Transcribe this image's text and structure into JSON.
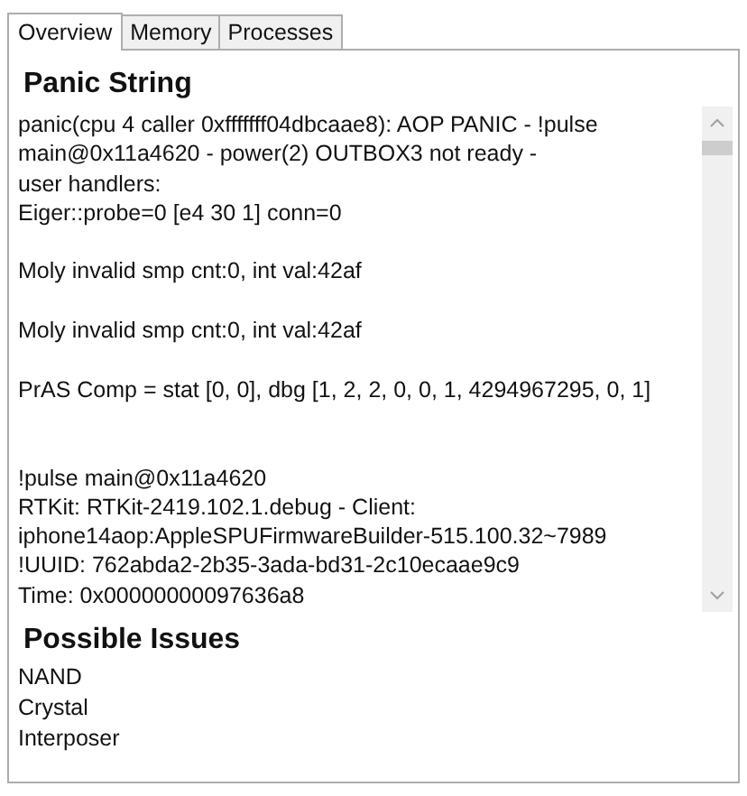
{
  "tabs": [
    {
      "label": "Overview",
      "selected": true
    },
    {
      "label": "Memory",
      "selected": false
    },
    {
      "label": "Processes",
      "selected": false
    }
  ],
  "panic_string": {
    "title": "Panic String",
    "text": "panic(cpu 4 caller 0xfffffff04dbcaae8): AOP PANIC - !pulse\nmain@0x11a4620 - power(2) OUTBOX3 not ready -\nuser handlers:\nEiger::probe=0 [e4 30 1] conn=0\n\nMoly invalid smp cnt:0, int val:42af\n\nMoly invalid smp cnt:0, int val:42af\n\nPrAS Comp = stat [0, 0], dbg [1, 2, 2, 0, 0, 1, 4294967295, 0, 1]\n\n\n!pulse main@0x11a4620\nRTKit: RTKit-2419.102.1.debug - Client:\niphone14aop:AppleSPUFirmwareBuilder-515.100.32~7989\n!UUID: 762abda2-2b35-3ada-bd31-2c10ecaae9c9\nTime: 0x00000000097636a8"
  },
  "possible_issues": {
    "title": "Possible Issues",
    "items": [
      "NAND",
      "Crystal",
      "Interposer"
    ]
  }
}
